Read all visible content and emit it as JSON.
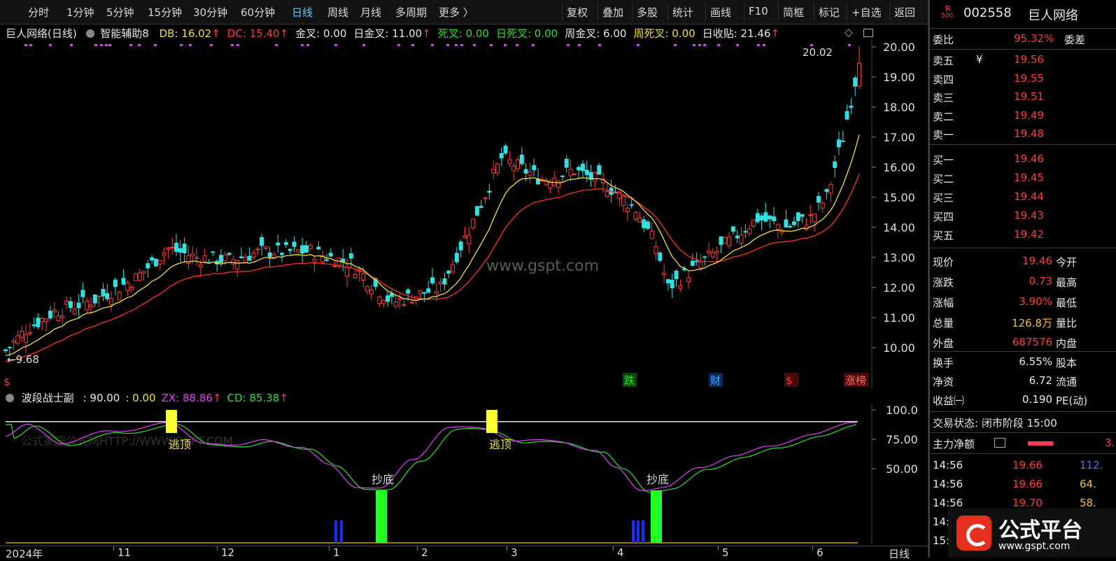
{
  "toolbar": {
    "items": [
      "分时",
      "1分钟",
      "5分钟",
      "15分钟",
      "30分钟",
      "60分钟",
      "日线",
      "周线",
      "月线",
      "多周期",
      "更多 〉"
    ],
    "active": "日线",
    "right_items": [
      "复权",
      "叠加",
      "多股",
      "统计",
      "画线",
      "F10",
      "简框",
      "标记",
      "+自选",
      "返回"
    ]
  },
  "main_chart": {
    "title": "巨人网络(日线)",
    "indicator": "智能辅助8",
    "stats": [
      {
        "label": "DB: 16.02",
        "color": "#f0e040",
        "arrow": "red"
      },
      {
        "label": "DC: 15.40",
        "color": "#ff3b3b",
        "arrow": "red"
      },
      {
        "label": "金叉: 0.00",
        "color": "#e8e8e8",
        "arrow": ""
      },
      {
        "label": "日金叉: 11.00",
        "color": "#e8e8e8",
        "arrow": "red"
      },
      {
        "label": "死叉: 0.00",
        "color": "#2ee02e",
        "arrow": ""
      },
      {
        "label": "日死叉: 0.00",
        "color": "#2ee02e",
        "arrow": ""
      },
      {
        "label": "周金叉: 6.00",
        "color": "#e8e8e8",
        "arrow": ""
      },
      {
        "label": "周死叉: 0.00",
        "color": "#f0e040",
        "arrow": ""
      },
      {
        "label": "日收贴: 21.46",
        "color": "#e8e8e8",
        "arrow": "red"
      }
    ],
    "y_ticks": [
      "20.00",
      "19.00",
      "18.00",
      "17.00",
      "16.00",
      "15.00",
      "14.00",
      "13.00",
      "12.00",
      "11.00",
      "10.00"
    ],
    "high_label": "20.02",
    "low_label": "9.68",
    "watermark": "www.gspt.com",
    "markers": [
      "跌",
      "财",
      "$",
      "涨榜"
    ]
  },
  "sub_chart": {
    "title": "波段战士副",
    "stats": [
      {
        "label": ": 90.00",
        "color": "#e8e8e8"
      },
      {
        "label": ": 0.00",
        "color": "#f0e040"
      },
      {
        "label": "ZX: 88.86",
        "color": "#e040fb"
      },
      {
        "label": "CD: 85.38",
        "color": "#2ee02e"
      }
    ],
    "y_ticks": [
      "100.0",
      "75.00",
      "50.00"
    ],
    "signals": [
      "逃顶",
      "抄底",
      "逃顶",
      "抄底"
    ],
    "faded_watermark": "公式家园公式网HTTP://WWW.GSPT.COM"
  },
  "x_axis": {
    "labels": [
      "2024年",
      "11",
      "12",
      "1",
      "2",
      "3",
      "4",
      "5",
      "6"
    ],
    "period": "日线"
  },
  "right_panel": {
    "code": "002558",
    "name": "巨人网络",
    "badge_top": "R",
    "badge_bottom": "500",
    "weibi_label": "委比",
    "weibi_value": "95.32%",
    "weicha_label": "委差",
    "asks": [
      {
        "label": "卖五",
        "price": "19.56",
        "yen": "¥"
      },
      {
        "label": "卖四",
        "price": "19.55"
      },
      {
        "label": "卖三",
        "price": "19.51"
      },
      {
        "label": "卖二",
        "price": "19.49"
      },
      {
        "label": "卖一",
        "price": "19.48"
      }
    ],
    "bids": [
      {
        "label": "买一",
        "price": "19.46"
      },
      {
        "label": "买二",
        "price": "19.45"
      },
      {
        "label": "买三",
        "price": "19.44"
      },
      {
        "label": "买四",
        "price": "19.43"
      },
      {
        "label": "买五",
        "price": "19.42"
      }
    ],
    "quotes": [
      {
        "label": "现价",
        "value": "19.46",
        "value_color": "#ff3b3b",
        "right": "今开"
      },
      {
        "label": "涨跌",
        "value": "0.73",
        "value_color": "#ff3b3b",
        "right": "最高"
      },
      {
        "label": "涨幅",
        "value": "3.90%",
        "value_color": "#ff3b3b",
        "right": "最低"
      },
      {
        "label": "总量",
        "value": "126.8万",
        "value_color": "#f0c040",
        "right": "量比"
      },
      {
        "label": "外盘",
        "value": "687576",
        "value_color": "#ff3b3b",
        "right": "内盘"
      }
    ],
    "fundamentals": [
      {
        "label": "换手",
        "value": "6.55%",
        "right": "股本"
      },
      {
        "label": "净资",
        "value": "6.72",
        "right": "流通"
      },
      {
        "label": "收益㈠",
        "value": "0.190",
        "right": "PE(动)"
      }
    ],
    "trade_status": "交易状态: 闭市阶段 15:00",
    "main_flow_label": "主力净额",
    "main_flow_value": "3.",
    "ticks": [
      {
        "time": "14:56",
        "price": "19.66",
        "vol": "112."
      },
      {
        "time": "14:56",
        "price": "19.66",
        "vol": "64."
      },
      {
        "time": "14:56",
        "price": "19.70",
        "vol": "58."
      },
      {
        "time": "14:56",
        "price": "",
        "vol": ""
      },
      {
        "time": "15:0",
        "price": "",
        "vol": ""
      }
    ]
  },
  "logo": {
    "text": "公式平台",
    "url": "www.gspt.com"
  },
  "colors": {
    "up": "#ff3b3b",
    "down": "#33e0e0",
    "ma_fast": "#f0e040",
    "ma_slow": "#ff3030",
    "zx": "#e040fb",
    "cd": "#2ee02e"
  }
}
